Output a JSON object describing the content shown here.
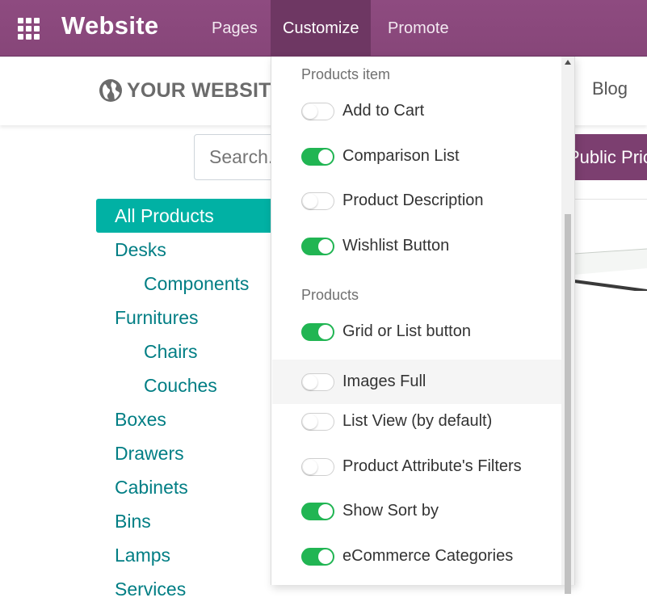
{
  "topbar": {
    "brand": "Website",
    "menu": [
      {
        "label": "Pages"
      },
      {
        "label": "Customize",
        "active": true
      },
      {
        "label": "Promote"
      }
    ]
  },
  "site_header": {
    "logo_text": "YOUR WEBSITE",
    "nav_blog": "Blog",
    "nav_partial": "'"
  },
  "search": {
    "placeholder": "Search..."
  },
  "pricelist_button": "Public Pricelist",
  "categories": [
    {
      "label": "All Products",
      "level": 0,
      "active": true
    },
    {
      "label": "Desks",
      "level": 0
    },
    {
      "label": "Components",
      "level": 1
    },
    {
      "label": "Furnitures",
      "level": 0
    },
    {
      "label": "Chairs",
      "level": 1
    },
    {
      "label": "Couches",
      "level": 1
    },
    {
      "label": "Boxes",
      "level": 0
    },
    {
      "label": "Drawers",
      "level": 0
    },
    {
      "label": "Cabinets",
      "level": 0
    },
    {
      "label": "Bins",
      "level": 0
    },
    {
      "label": "Lamps",
      "level": 0
    },
    {
      "label": "Services",
      "level": 0
    }
  ],
  "customize_menu": {
    "sections": [
      {
        "title": "Products item",
        "options": [
          {
            "label": "Add to Cart",
            "enabled": false
          },
          {
            "label": "Comparison List",
            "enabled": true
          },
          {
            "label": "Product Description",
            "enabled": false
          },
          {
            "label": "Wishlist Button",
            "enabled": true
          }
        ]
      },
      {
        "title": "Products",
        "options": [
          {
            "label": "Grid or List button",
            "enabled": true
          },
          {
            "label": "Images Full",
            "enabled": false,
            "hovered": true
          },
          {
            "label": "List View (by default)",
            "enabled": false
          },
          {
            "label": "Product Attribute's Filters",
            "enabled": false
          },
          {
            "label": "Show Sort by",
            "enabled": true
          },
          {
            "label": "eCommerce Categories",
            "enabled": true
          }
        ]
      }
    ]
  },
  "colors": {
    "topbar": "#8e4b80",
    "active_menu": "#6e3763",
    "category_active": "#01b1a4",
    "category_text": "#017e84",
    "toggle_on": "#21b553"
  }
}
